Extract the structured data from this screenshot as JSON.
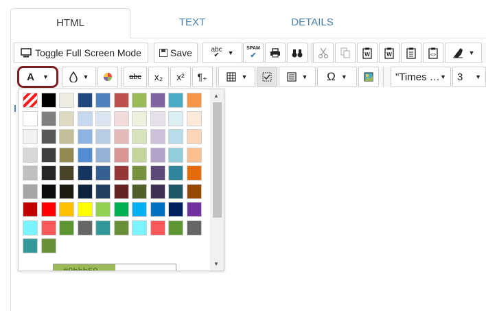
{
  "tabs": [
    {
      "label": "HTML",
      "active": true
    },
    {
      "label": "TEXT",
      "active": false
    },
    {
      "label": "DETAILS",
      "active": false
    }
  ],
  "toolbar1": {
    "fullscreen_label": "Toggle Full Screen Mode",
    "save_label": "Save",
    "spellcheck_icon_text": "abc",
    "spam_icon_text": "SPAM"
  },
  "toolbar2": {
    "font_color_label": "A",
    "strike_label": "abc",
    "subscript_label": "x₂",
    "superscript_label": "x²",
    "paragraph_label": "¶₊",
    "special_char_label": "Ω",
    "font_family_value": "\"Times …",
    "font_size_value": "3"
  },
  "color_picker": {
    "hex_value": "#9bbb59",
    "rows": [
      [
        "none",
        "#000000",
        "#eeece1",
        "#1f497d",
        "#4f81bd",
        "#c0504d",
        "#9bbb59",
        "#8064a2",
        "#4bacc6",
        "#f79646"
      ],
      [
        "#ffffff",
        "#7f7f7f",
        "#ddd9c3",
        "#c6d9f0",
        "#dbe5f1",
        "#f2dcdb",
        "#ebf1dd",
        "#e5e0ec",
        "#dbeef3",
        "#fdeada"
      ],
      [
        "#f2f2f2",
        "#595959",
        "#c4bd97",
        "#8db3e2",
        "#b8cce4",
        "#e5b9b7",
        "#d7e3bc",
        "#ccc1d9",
        "#b7dde8",
        "#fbd5b5"
      ],
      [
        "#d8d8d8",
        "#3f3f3f",
        "#938953",
        "#548dd4",
        "#95b3d7",
        "#d99694",
        "#c3d69b",
        "#b2a2c7",
        "#92cddc",
        "#fac08f"
      ],
      [
        "#bfbfbf",
        "#262626",
        "#494429",
        "#17365d",
        "#366092",
        "#953734",
        "#76923c",
        "#5f497a",
        "#31859b",
        "#e36c09"
      ],
      [
        "#a5a5a5",
        "#0c0c0c",
        "#1d1b10",
        "#0f243e",
        "#244061",
        "#632423",
        "#4f6128",
        "#3f3151",
        "#205867",
        "#974806"
      ],
      [
        "#c00000",
        "#ff0000",
        "#ffc000",
        "#ffff00",
        "#92d050",
        "#00b050",
        "#00b0f0",
        "#0070c0",
        "#002060",
        "#7030a0"
      ],
      [
        "#77f4ff",
        "#f75a5a",
        "#5e9632",
        "#666666",
        "#35989b",
        "#6a9137",
        "#7cf4ff",
        "#f75a5a",
        "#5e9632",
        "#666666"
      ],
      [
        "#35989b",
        "#6a9137"
      ]
    ]
  }
}
